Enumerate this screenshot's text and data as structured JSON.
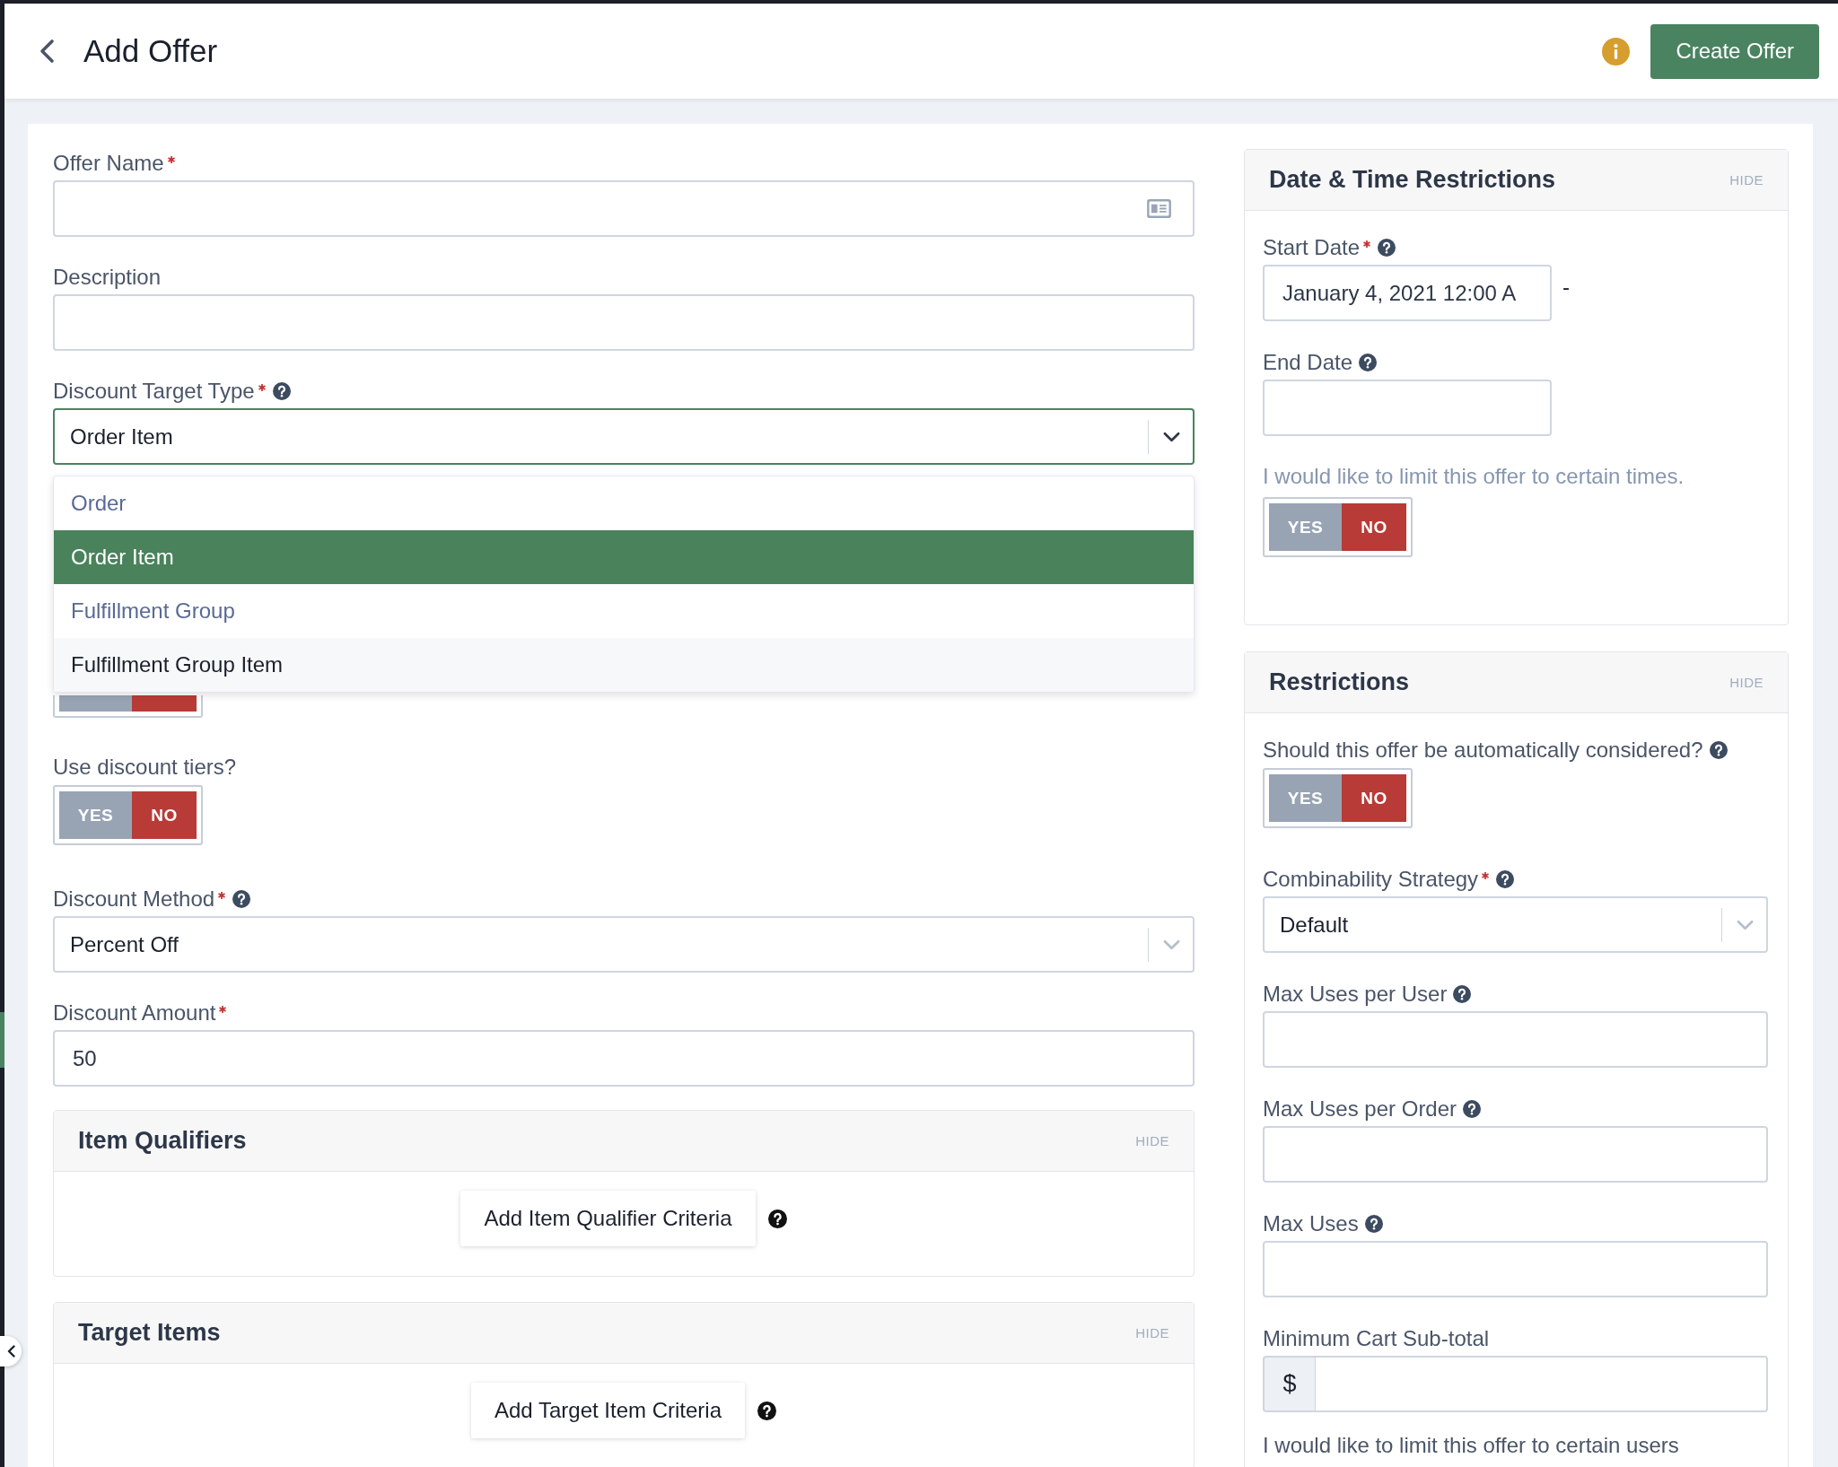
{
  "header": {
    "title": "Add Offer",
    "primary_button": "Create Offer"
  },
  "main": {
    "fields": [
      {
        "kind": "text",
        "label": "Offer Name",
        "required": true,
        "help": false,
        "icon": true
      },
      {
        "kind": "text",
        "label": "Description",
        "required": false,
        "help": false,
        "icon": false
      },
      {
        "kind": "select",
        "label": "Discount Target Type",
        "required": true,
        "help": true,
        "value": "Order Item",
        "focused": true,
        "open": true,
        "options": [
          {
            "label": "Order",
            "selected": false,
            "hovered": false
          },
          {
            "label": "Order Item",
            "selected": true,
            "hovered": false
          },
          {
            "label": "Fulfillment Group",
            "selected": false,
            "hovered": false
          },
          {
            "label": "Fulfillment Group Item",
            "selected": false,
            "hovered": true
          }
        ]
      },
      {
        "kind": "covered",
        "on": false
      },
      {
        "kind": "toggle",
        "label": "Use discount tiers?",
        "help": false,
        "on": false,
        "yes": "YES",
        "no": "NO"
      },
      {
        "kind": "select",
        "label": "Discount Method",
        "required": true,
        "help": true,
        "value": "Percent Off",
        "focused": false
      },
      {
        "kind": "text",
        "label": "Discount Amount",
        "required": true,
        "help": false,
        "icon": false,
        "value": "50"
      }
    ],
    "panels": [
      {
        "title": "Item Qualifiers",
        "hide": "HIDE",
        "button": "Add Item Qualifier Criteria",
        "help": true
      },
      {
        "title": "Target Items",
        "hide": "HIDE",
        "button": "Add Target Item Criteria",
        "help": true
      }
    ]
  },
  "side_panels": [
    {
      "title": "Date & Time Restrictions",
      "hide": "HIDE",
      "fields": [
        {
          "kind": "date",
          "label": "Start Date",
          "required": true,
          "help": true,
          "value": "January 4, 2021 12:00 A",
          "separator": "-"
        },
        {
          "kind": "date",
          "label": "End Date",
          "required": false,
          "help": true
        },
        {
          "kind": "note",
          "text": "I would like to limit this offer to certain times.",
          "muted": true
        },
        {
          "kind": "toggle",
          "on": false,
          "yes": "YES",
          "no": "NO"
        }
      ]
    },
    {
      "title": "Restrictions",
      "hide": "HIDE",
      "fields": [
        {
          "kind": "toggle",
          "label": "Should this offer be automatically considered?",
          "help": true,
          "on": false,
          "yes": "YES",
          "no": "NO"
        },
        {
          "kind": "select",
          "label": "Combinability Strategy",
          "required": true,
          "help": true,
          "value": "Default",
          "focused": false
        },
        {
          "kind": "text",
          "label": "Max Uses per User",
          "required": false,
          "help": true,
          "icon": false
        },
        {
          "kind": "text",
          "label": "Max Uses per Order",
          "required": false,
          "help": true,
          "icon": false
        },
        {
          "kind": "text",
          "label": "Max Uses",
          "required": false,
          "help": true,
          "icon": false
        },
        {
          "kind": "currency",
          "label": "Minimum Cart Sub-total",
          "required": false,
          "help": false,
          "prefix": "$"
        },
        {
          "kind": "note",
          "text": "I would like to limit this offer to certain users",
          "muted": false
        }
      ]
    }
  ]
}
